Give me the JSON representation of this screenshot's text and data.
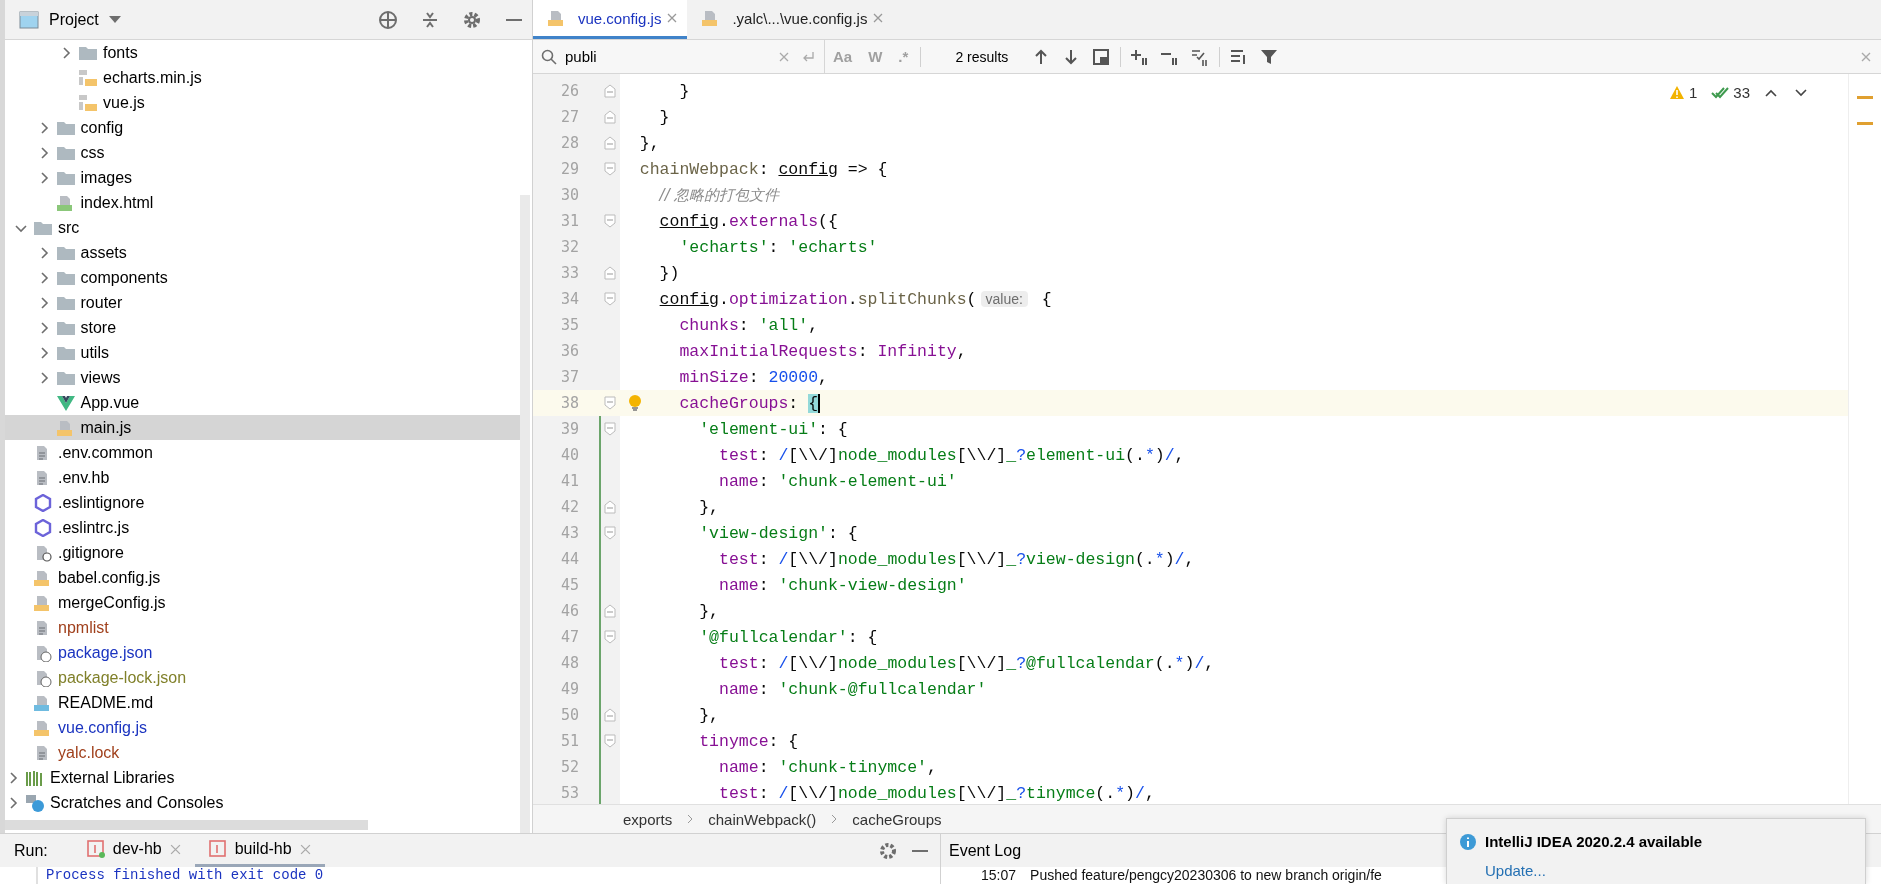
{
  "project_panel": {
    "title": "Project",
    "tree": [
      {
        "children": [
          {
            "children": [
              {
                "children": [
                  {
                    "label": "fonts",
                    "kind": "folder",
                    "expanded": false,
                    "selected": false,
                    "color": "#000000"
                  },
                  {
                    "label": "echarts.min.js",
                    "kind": "js-lib",
                    "selected": false,
                    "color": "#000000"
                  },
                  {
                    "label": "vue.js",
                    "kind": "js-lib",
                    "selected": false,
                    "color": "#000000"
                  }
                ]
              },
              {
                "label": "config",
                "kind": "folder",
                "expanded": false,
                "selected": false,
                "color": "#000000"
              },
              {
                "label": "css",
                "kind": "folder",
                "expanded": false,
                "selected": false,
                "color": "#000000"
              },
              {
                "label": "images",
                "kind": "folder",
                "expanded": false,
                "selected": false,
                "color": "#000000"
              },
              {
                "label": "index.html",
                "kind": "html",
                "selected": false,
                "color": "#000000"
              }
            ]
          },
          {
            "label": "src",
            "kind": "folder",
            "expanded": true,
            "selected": false,
            "color": "#000000",
            "children": [
              {
                "label": "assets",
                "kind": "folder",
                "expanded": false,
                "selected": false,
                "color": "#000000"
              },
              {
                "label": "components",
                "kind": "folder",
                "expanded": false,
                "selected": false,
                "color": "#000000"
              },
              {
                "label": "router",
                "kind": "folder",
                "expanded": false,
                "selected": false,
                "color": "#000000"
              },
              {
                "label": "store",
                "kind": "folder",
                "expanded": false,
                "selected": false,
                "color": "#000000"
              },
              {
                "label": "utils",
                "kind": "folder",
                "expanded": false,
                "selected": false,
                "color": "#000000"
              },
              {
                "label": "views",
                "kind": "folder",
                "expanded": false,
                "selected": false,
                "color": "#000000"
              },
              {
                "label": "App.vue",
                "kind": "vue",
                "selected": false,
                "color": "#000000"
              },
              {
                "label": "main.js",
                "kind": "js",
                "selected": true,
                "color": "#000000"
              }
            ]
          },
          {
            "label": ".env.common",
            "kind": "text",
            "selected": false,
            "color": "#000000"
          },
          {
            "label": ".env.hb",
            "kind": "text",
            "selected": false,
            "color": "#000000"
          },
          {
            "label": ".eslintignore",
            "kind": "eslint",
            "selected": false,
            "color": "#000000"
          },
          {
            "label": ".eslintrc.js",
            "kind": "eslint",
            "selected": false,
            "color": "#000000"
          },
          {
            "label": ".gitignore",
            "kind": "gitignore",
            "selected": false,
            "color": "#000000"
          },
          {
            "label": "babel.config.js",
            "kind": "js",
            "selected": false,
            "color": "#000000"
          },
          {
            "label": "mergeConfig.js",
            "kind": "js",
            "selected": false,
            "color": "#000000"
          },
          {
            "label": "npmlist",
            "kind": "text",
            "selected": false,
            "color": "#a0401c"
          },
          {
            "label": "package.json",
            "kind": "json",
            "selected": false,
            "color": "#1b34c0"
          },
          {
            "label": "package-lock.json",
            "kind": "json",
            "selected": false,
            "color": "#80802a"
          },
          {
            "label": "README.md",
            "kind": "md",
            "selected": false,
            "color": "#000000"
          },
          {
            "label": "vue.config.js",
            "kind": "js",
            "selected": false,
            "color": "#1b34c0"
          },
          {
            "label": "yalc.lock",
            "kind": "text",
            "selected": false,
            "color": "#a0401c"
          }
        ]
      },
      {
        "label": "External Libraries",
        "kind": "libraries",
        "expanded": false,
        "selected": false,
        "color": "#000000"
      },
      {
        "label": "Scratches and Consoles",
        "kind": "scratches",
        "expanded": false,
        "selected": false,
        "color": "#000000"
      }
    ]
  },
  "editor": {
    "tabs": [
      {
        "label": "vue.config.js",
        "selected": true
      },
      {
        "label": ".yalc\\...\\vue.config.js",
        "selected": false
      }
    ],
    "find": {
      "value": "publi",
      "match_case": "Aa",
      "words": "W",
      "regex": ".*",
      "results": "2 results"
    },
    "inspections": {
      "warnings": "1",
      "passed": "33"
    },
    "lines": [
      {
        "number": "26",
        "kind": "fold-end",
        "changed": false,
        "current": false,
        "tokens": [
          {
            "kind": "plain",
            "text": "      }"
          }
        ]
      },
      {
        "number": "27",
        "kind": "fold-end",
        "changed": false,
        "current": false,
        "tokens": [
          {
            "kind": "plain",
            "text": "    }"
          }
        ]
      },
      {
        "number": "28",
        "kind": "fold-end",
        "changed": false,
        "current": false,
        "tokens": [
          {
            "kind": "plain",
            "text": "  },"
          }
        ]
      },
      {
        "number": "29",
        "kind": "fold-start",
        "changed": false,
        "current": false,
        "tokens": [
          {
            "kind": "member",
            "text": "  chainWebpack"
          },
          {
            "kind": "plain",
            "text": ": "
          },
          {
            "kind": "ident",
            "text": "config"
          },
          {
            "kind": "plain",
            "text": " => {"
          }
        ]
      },
      {
        "number": "30",
        "kind": "plain",
        "changed": false,
        "current": false,
        "tokens": [
          {
            "kind": "comment",
            "text": "    // 忽略的打包文件"
          }
        ]
      },
      {
        "number": "31",
        "kind": "fold-start",
        "changed": false,
        "current": false,
        "tokens": [
          {
            "kind": "ident",
            "text": "    config"
          },
          {
            "kind": "plain",
            "text": "."
          },
          {
            "kind": "key",
            "text": "externals"
          },
          {
            "kind": "plain",
            "text": "({"
          }
        ]
      },
      {
        "number": "32",
        "kind": "plain",
        "changed": false,
        "current": false,
        "tokens": [
          {
            "kind": "str",
            "text": "      'echarts'"
          },
          {
            "kind": "plain",
            "text": ": "
          },
          {
            "kind": "str",
            "text": "'echarts'"
          }
        ]
      },
      {
        "number": "33",
        "kind": "fold-end",
        "changed": false,
        "current": false,
        "tokens": [
          {
            "kind": "plain",
            "text": "    })"
          }
        ]
      },
      {
        "number": "34",
        "kind": "fold-start",
        "changed": false,
        "current": false,
        "tokens": [
          {
            "kind": "ident",
            "text": "    config"
          },
          {
            "kind": "plain",
            "text": "."
          },
          {
            "kind": "key",
            "text": "optimization"
          },
          {
            "kind": "plain",
            "text": "."
          },
          {
            "kind": "member",
            "text": "splitChunks"
          },
          {
            "kind": "plain",
            "text": "("
          },
          {
            "kind": "hint",
            "text": "value:"
          },
          {
            "kind": "plain",
            "text": " {"
          }
        ]
      },
      {
        "number": "35",
        "kind": "plain",
        "changed": false,
        "current": false,
        "tokens": [
          {
            "kind": "key",
            "text": "      chunks"
          },
          {
            "kind": "plain",
            "text": ": "
          },
          {
            "kind": "str",
            "text": "'all'"
          },
          {
            "kind": "plain",
            "text": ","
          }
        ]
      },
      {
        "number": "36",
        "kind": "plain",
        "changed": false,
        "current": false,
        "tokens": [
          {
            "kind": "key",
            "text": "      maxInitialRequests"
          },
          {
            "kind": "plain",
            "text": ": "
          },
          {
            "kind": "key",
            "text": "Infinity"
          },
          {
            "kind": "plain",
            "text": ","
          }
        ]
      },
      {
        "number": "37",
        "kind": "plain",
        "changed": false,
        "current": false,
        "tokens": [
          {
            "kind": "key",
            "text": "      minSize"
          },
          {
            "kind": "plain",
            "text": ": "
          },
          {
            "kind": "num",
            "text": "20000"
          },
          {
            "kind": "plain",
            "text": ","
          }
        ]
      },
      {
        "number": "38",
        "kind": "fold-start",
        "changed": false,
        "current": true,
        "tokens": [
          {
            "kind": "key",
            "text": "      cacheGroups"
          },
          {
            "kind": "plain",
            "text": ": "
          },
          {
            "kind": "match",
            "text": "{"
          }
        ]
      },
      {
        "number": "39",
        "kind": "fold-start",
        "changed": true,
        "current": false,
        "tokens": [
          {
            "kind": "str",
            "text": "        'element-ui'"
          },
          {
            "kind": "plain",
            "text": ": {"
          }
        ]
      },
      {
        "number": "40",
        "kind": "plain",
        "changed": true,
        "current": false,
        "tokens": [
          {
            "kind": "key",
            "text": "          test"
          },
          {
            "kind": "plain",
            "text": ": "
          },
          {
            "kind": "op",
            "text": "/"
          },
          {
            "kind": "plain",
            "text": "[\\\\/]"
          },
          {
            "kind": "str",
            "text": "node_modules"
          },
          {
            "kind": "plain",
            "text": "[\\\\/]"
          },
          {
            "kind": "str",
            "text": "_"
          },
          {
            "kind": "op",
            "text": "?"
          },
          {
            "kind": "str",
            "text": "element-ui"
          },
          {
            "kind": "plain",
            "text": "(."
          },
          {
            "kind": "op",
            "text": "*"
          },
          {
            "kind": "plain",
            "text": ")"
          },
          {
            "kind": "op",
            "text": "/"
          },
          {
            "kind": "plain",
            "text": ","
          }
        ]
      },
      {
        "number": "41",
        "kind": "plain",
        "changed": true,
        "current": false,
        "tokens": [
          {
            "kind": "key",
            "text": "          name"
          },
          {
            "kind": "plain",
            "text": ": "
          },
          {
            "kind": "str",
            "text": "'chunk-element-ui'"
          }
        ]
      },
      {
        "number": "42",
        "kind": "fold-end",
        "changed": true,
        "current": false,
        "tokens": [
          {
            "kind": "plain",
            "text": "        },"
          }
        ]
      },
      {
        "number": "43",
        "kind": "fold-start",
        "changed": true,
        "current": false,
        "tokens": [
          {
            "kind": "str",
            "text": "        'view-design'"
          },
          {
            "kind": "plain",
            "text": ": {"
          }
        ]
      },
      {
        "number": "44",
        "kind": "plain",
        "changed": true,
        "current": false,
        "tokens": [
          {
            "kind": "key",
            "text": "          test"
          },
          {
            "kind": "plain",
            "text": ": "
          },
          {
            "kind": "op",
            "text": "/"
          },
          {
            "kind": "plain",
            "text": "[\\\\/]"
          },
          {
            "kind": "str",
            "text": "node_modules"
          },
          {
            "kind": "plain",
            "text": "[\\\\/]"
          },
          {
            "kind": "str",
            "text": "_"
          },
          {
            "kind": "op",
            "text": "?"
          },
          {
            "kind": "str",
            "text": "view-design"
          },
          {
            "kind": "plain",
            "text": "(."
          },
          {
            "kind": "op",
            "text": "*"
          },
          {
            "kind": "plain",
            "text": ")"
          },
          {
            "kind": "op",
            "text": "/"
          },
          {
            "kind": "plain",
            "text": ","
          }
        ]
      },
      {
        "number": "45",
        "kind": "plain",
        "changed": true,
        "current": false,
        "tokens": [
          {
            "kind": "key",
            "text": "          name"
          },
          {
            "kind": "plain",
            "text": ": "
          },
          {
            "kind": "str",
            "text": "'chunk-view-design'"
          }
        ]
      },
      {
        "number": "46",
        "kind": "fold-end",
        "changed": true,
        "current": false,
        "tokens": [
          {
            "kind": "plain",
            "text": "        },"
          }
        ]
      },
      {
        "number": "47",
        "kind": "fold-start",
        "changed": true,
        "current": false,
        "tokens": [
          {
            "kind": "str",
            "text": "        '@fullcalendar'"
          },
          {
            "kind": "plain",
            "text": ": {"
          }
        ]
      },
      {
        "number": "48",
        "kind": "plain",
        "changed": true,
        "current": false,
        "tokens": [
          {
            "kind": "key",
            "text": "          test"
          },
          {
            "kind": "plain",
            "text": ": "
          },
          {
            "kind": "op",
            "text": "/"
          },
          {
            "kind": "plain",
            "text": "[\\\\/]"
          },
          {
            "kind": "str",
            "text": "node_modules"
          },
          {
            "kind": "plain",
            "text": "[\\\\/]"
          },
          {
            "kind": "str",
            "text": "_"
          },
          {
            "kind": "op",
            "text": "?"
          },
          {
            "kind": "str",
            "text": "@fullcalendar"
          },
          {
            "kind": "plain",
            "text": "(."
          },
          {
            "kind": "op",
            "text": "*"
          },
          {
            "kind": "plain",
            "text": ")"
          },
          {
            "kind": "op",
            "text": "/"
          },
          {
            "kind": "plain",
            "text": ","
          }
        ]
      },
      {
        "number": "49",
        "kind": "plain",
        "changed": true,
        "current": false,
        "tokens": [
          {
            "kind": "key",
            "text": "          name"
          },
          {
            "kind": "plain",
            "text": ": "
          },
          {
            "kind": "str",
            "text": "'chunk-@fullcalendar'"
          }
        ]
      },
      {
        "number": "50",
        "kind": "fold-end",
        "changed": true,
        "current": false,
        "tokens": [
          {
            "kind": "plain",
            "text": "        },"
          }
        ]
      },
      {
        "number": "51",
        "kind": "fold-start",
        "changed": true,
        "current": false,
        "tokens": [
          {
            "kind": "key",
            "text": "        tinymce"
          },
          {
            "kind": "plain",
            "text": ": {"
          }
        ]
      },
      {
        "number": "52",
        "kind": "plain",
        "changed": true,
        "current": false,
        "tokens": [
          {
            "kind": "key",
            "text": "          name"
          },
          {
            "kind": "plain",
            "text": ": "
          },
          {
            "kind": "str",
            "text": "'chunk-tinymce'"
          },
          {
            "kind": "plain",
            "text": ","
          }
        ]
      },
      {
        "number": "53",
        "kind": "plain",
        "changed": true,
        "current": false,
        "tokens": [
          {
            "kind": "key",
            "text": "          test"
          },
          {
            "kind": "plain",
            "text": ": "
          },
          {
            "kind": "op",
            "text": "/"
          },
          {
            "kind": "plain",
            "text": "[\\\\/]"
          },
          {
            "kind": "str",
            "text": "node_modules"
          },
          {
            "kind": "plain",
            "text": "[\\\\/]"
          },
          {
            "kind": "str",
            "text": "_"
          },
          {
            "kind": "op",
            "text": "?"
          },
          {
            "kind": "str",
            "text": "tinymce"
          },
          {
            "kind": "plain",
            "text": "(."
          },
          {
            "kind": "op",
            "text": "*"
          },
          {
            "kind": "plain",
            "text": ")"
          },
          {
            "kind": "op",
            "text": "/"
          },
          {
            "kind": "plain",
            "text": ","
          }
        ]
      }
    ],
    "breadcrumbs": [
      "exports",
      "chainWebpack()",
      "cacheGroups"
    ]
  },
  "run_panel": {
    "label": "Run:",
    "tabs": [
      {
        "label": "dev-hb",
        "selected": false,
        "running": true
      },
      {
        "label": "build-hb",
        "selected": true,
        "running": false
      }
    ],
    "console": "Process finished with exit code 0"
  },
  "event_log": {
    "title": "Event Log",
    "time": "15:07",
    "message": "Pushed feature/pengcy20230306 to new branch origin/fe"
  },
  "notification": {
    "title": "IntelliJ IDEA 2020.2.4 available",
    "link": "Update..."
  }
}
